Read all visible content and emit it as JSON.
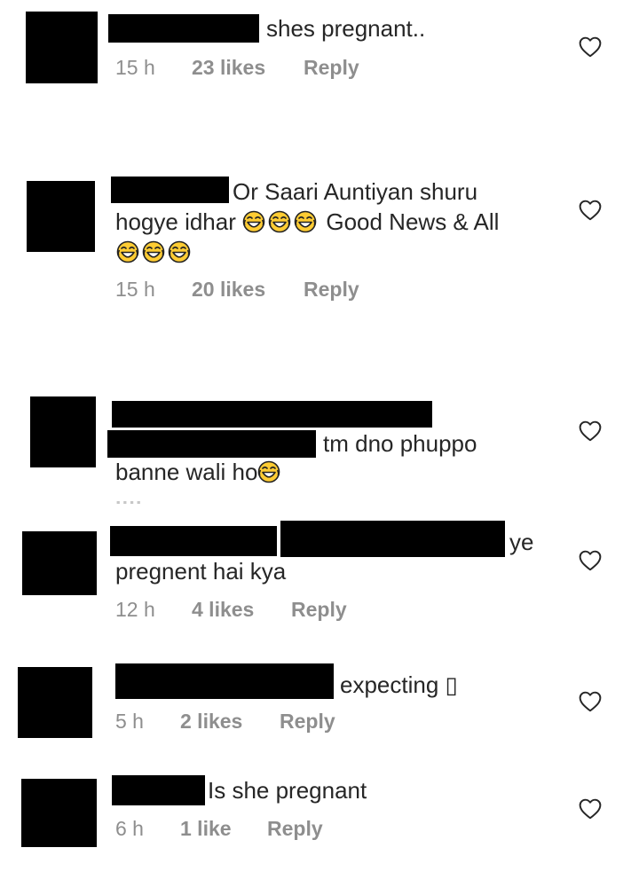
{
  "comments": [
    {
      "text": "shes pregnant..",
      "time": "15 h",
      "likes": "23 likes",
      "reply": "Reply"
    },
    {
      "text_line1": "Or Saari Auntiyan shuru",
      "text_line2_a": "hogye idhar",
      "text_line2_b": "Good News & All",
      "time": "15 h",
      "likes": "20 likes",
      "reply": "Reply"
    },
    {
      "text_line1": "tm dno phuppo",
      "text_line2": "banne wali ho"
    },
    {
      "text_line1": "ye",
      "text_line2": "pregnent hai kya",
      "time": "12 h",
      "likes": "4 likes",
      "reply": "Reply"
    },
    {
      "text": "expecting ▯",
      "time": "5 h",
      "likes": "2 likes",
      "reply": "Reply"
    },
    {
      "text": "Is she pregnant",
      "time": "6 h",
      "likes": "1 like",
      "reply": "Reply"
    }
  ],
  "icons": {
    "like": "heart-outline-icon",
    "emoji": "laughing-tears-emoji"
  },
  "colors": {
    "text": "#262626",
    "meta": "#8e8e8e",
    "redaction": "#000000",
    "heart": "#262626"
  }
}
